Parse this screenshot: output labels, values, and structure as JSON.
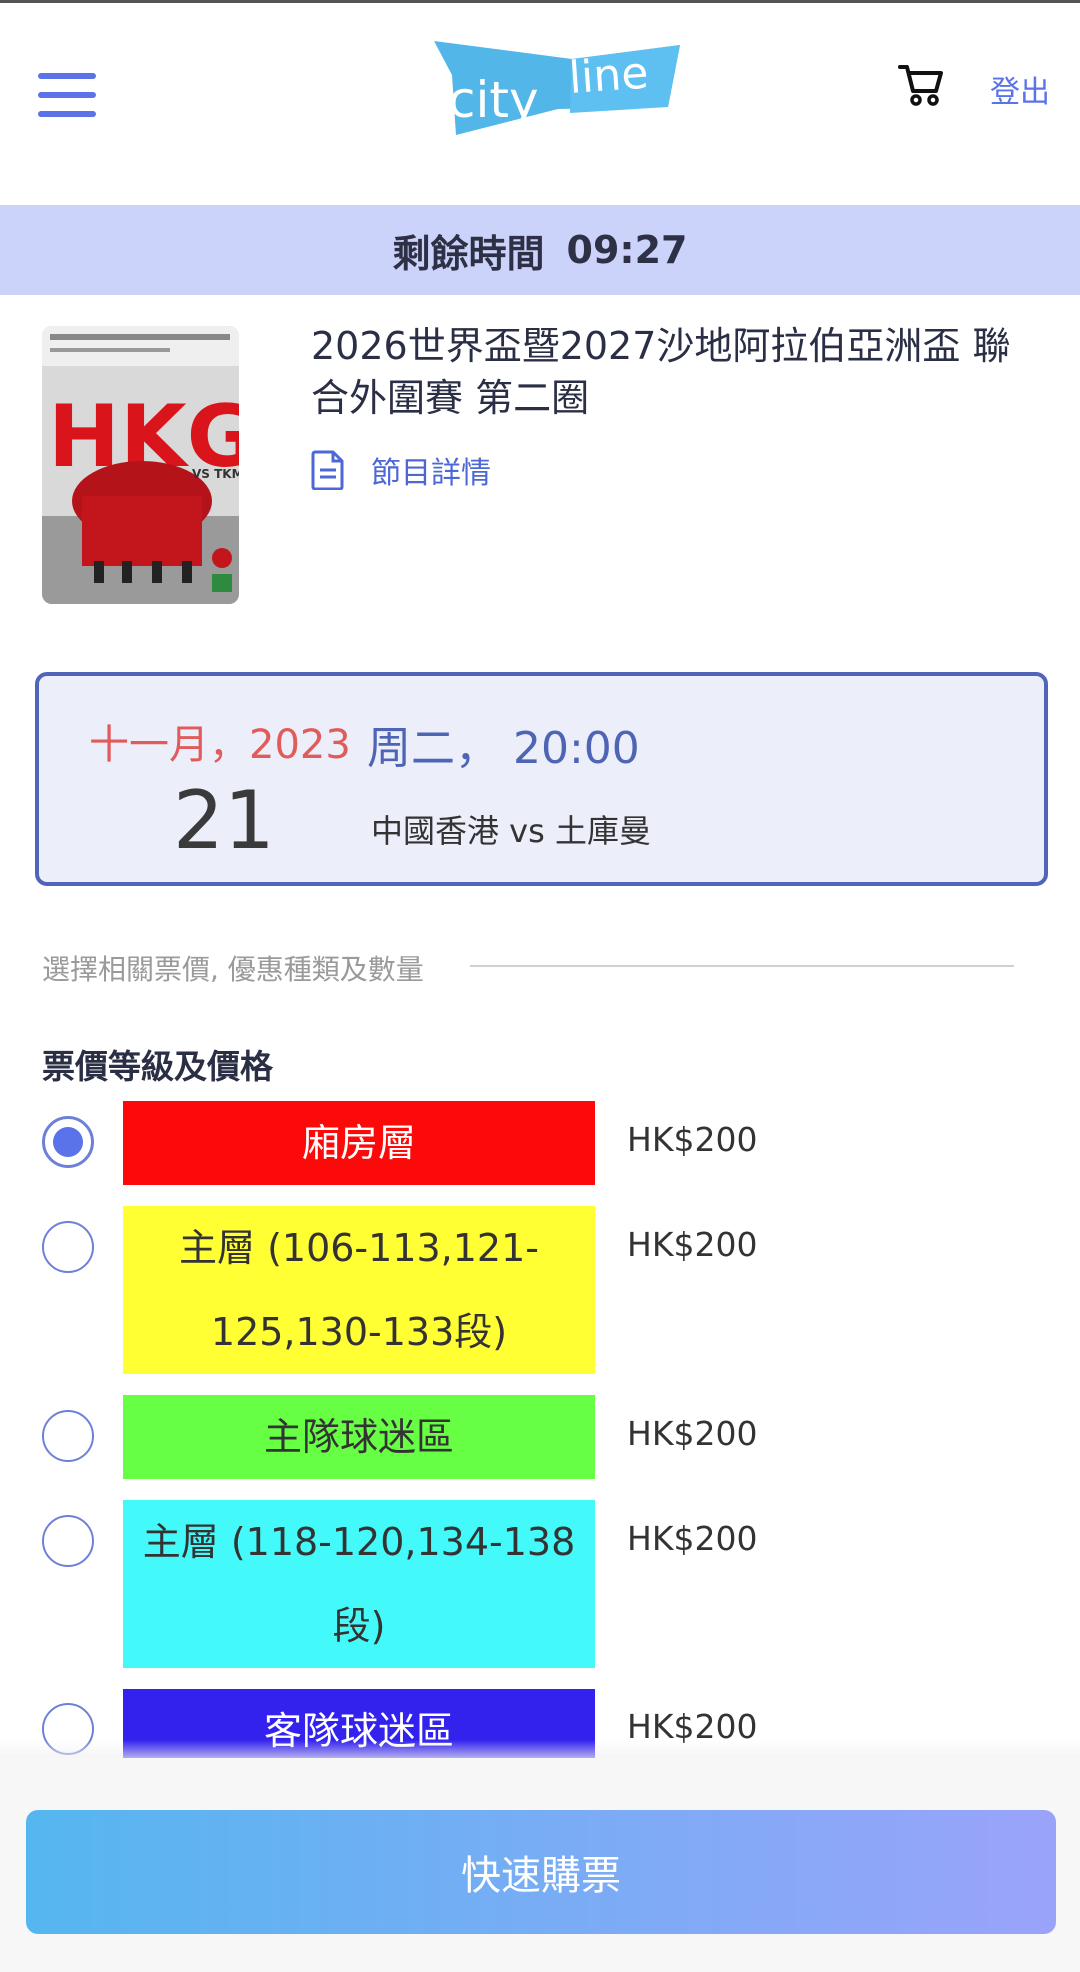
{
  "header": {
    "logo_text_city": "city",
    "logo_text_line": "line",
    "logout_label": "登出"
  },
  "timer": {
    "label": "剩餘時間",
    "value": "09:27"
  },
  "event": {
    "title": "2026世界盃暨2027沙地阿拉伯亞洲盃 聯合外圍賽 第二圈",
    "details_label": "節目詳情",
    "poster_text": "HKG",
    "poster_sub": "VS TKM"
  },
  "date_card": {
    "month_year": "十一月，2023",
    "day": "21",
    "weekday_time": "周二， 20:00",
    "match": "中國香港 vs 土庫曼"
  },
  "section": {
    "hint": "選擇相關票價, 優惠種類及數量",
    "price_heading": "票價等級及價格"
  },
  "tiers": [
    {
      "label": "廂房層",
      "price": "HK$200",
      "color": "#fc0a0a",
      "text_color": "#ffffff",
      "selected": true
    },
    {
      "label": "主層 (106-113,121-125,130-133段)",
      "price": "HK$200",
      "color": "#ffff33",
      "text_color": "#333333",
      "selected": false
    },
    {
      "label": "主隊球迷區",
      "price": "HK$200",
      "color": "#66ff44",
      "text_color": "#333333",
      "selected": false
    },
    {
      "label": "主層 (118-120,134-138段)",
      "price": "HK$200",
      "color": "#44f9f9",
      "text_color": "#333333",
      "selected": false
    },
    {
      "label": "客隊球迷區",
      "price": "HK$200",
      "color": "#3322ee",
      "text_color": "#ffffff",
      "selected": false
    }
  ],
  "footer": {
    "buy_label": "快速購票"
  }
}
